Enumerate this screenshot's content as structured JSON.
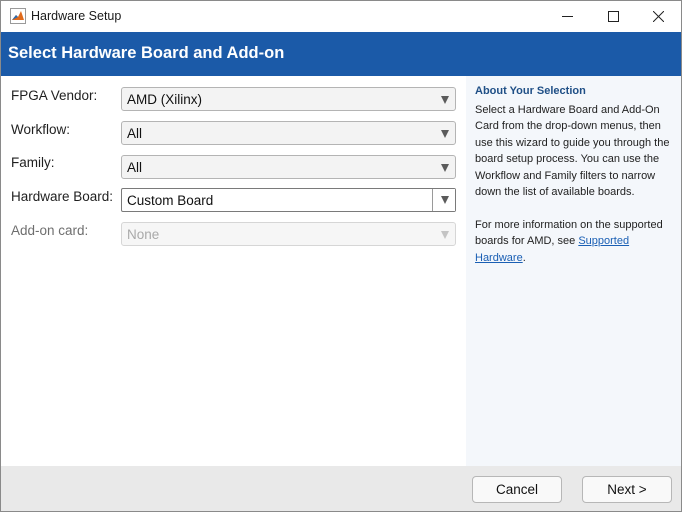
{
  "window": {
    "title": "Hardware Setup",
    "icon": "matlab-icon"
  },
  "banner": {
    "title": "Select Hardware Board and Add-on"
  },
  "form": {
    "fpga_vendor": {
      "label": "FPGA Vendor:",
      "value": "AMD (Xilinx)"
    },
    "workflow": {
      "label": "Workflow:",
      "value": "All"
    },
    "family": {
      "label": "Family:",
      "value": "All"
    },
    "hardware_board": {
      "label": "Hardware Board:",
      "value": "Custom Board"
    },
    "addon_card": {
      "label": "Add-on card:",
      "value": "None",
      "enabled": false
    }
  },
  "info": {
    "title": "About Your Selection",
    "para1": "Select a Hardware Board and Add-On Card from the drop-down menus, then use this wizard to guide you through the board setup process. You can use the Workflow and Family filters to narrow down the list of available boards.",
    "para2_prefix": "For more information on the supported boards for AMD, see ",
    "para2_link": "Supported Hardware",
    "para2_suffix": "."
  },
  "footer": {
    "cancel_label": "Cancel",
    "next_label": "Next >"
  },
  "colors": {
    "banner": "#1b5aa8",
    "info_title": "#1f4f86",
    "link": "#1a5fb4",
    "footer": "#e9e9e9"
  }
}
